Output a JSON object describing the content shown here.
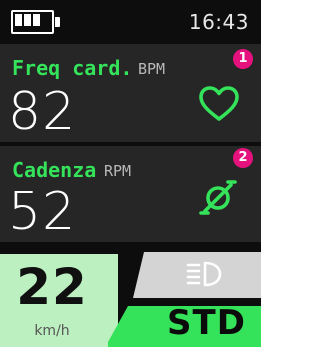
{
  "status_bar": {
    "time": "16:43",
    "battery_level": 0.75,
    "battery_icon": "battery-icon"
  },
  "metrics": [
    {
      "label": "Freq card.",
      "unit": "BPM",
      "value": "82",
      "icon": "heart-icon",
      "badge": "1"
    },
    {
      "label": "Cadenza",
      "unit": "RPM",
      "value": "52",
      "icon": "pedal-crank-icon",
      "badge": "2"
    }
  ],
  "speed": {
    "value": "22",
    "unit": "km/h"
  },
  "light": {
    "icon": "headlight-icon",
    "state": "off"
  },
  "assist_mode": {
    "label": "STD"
  },
  "colors": {
    "accent_green": "#35e35a",
    "badge_magenta": "#e5127d",
    "speed_bg": "#bdf0c1",
    "panel_bg": "#262626",
    "screen_bg": "#0d0d0d"
  }
}
